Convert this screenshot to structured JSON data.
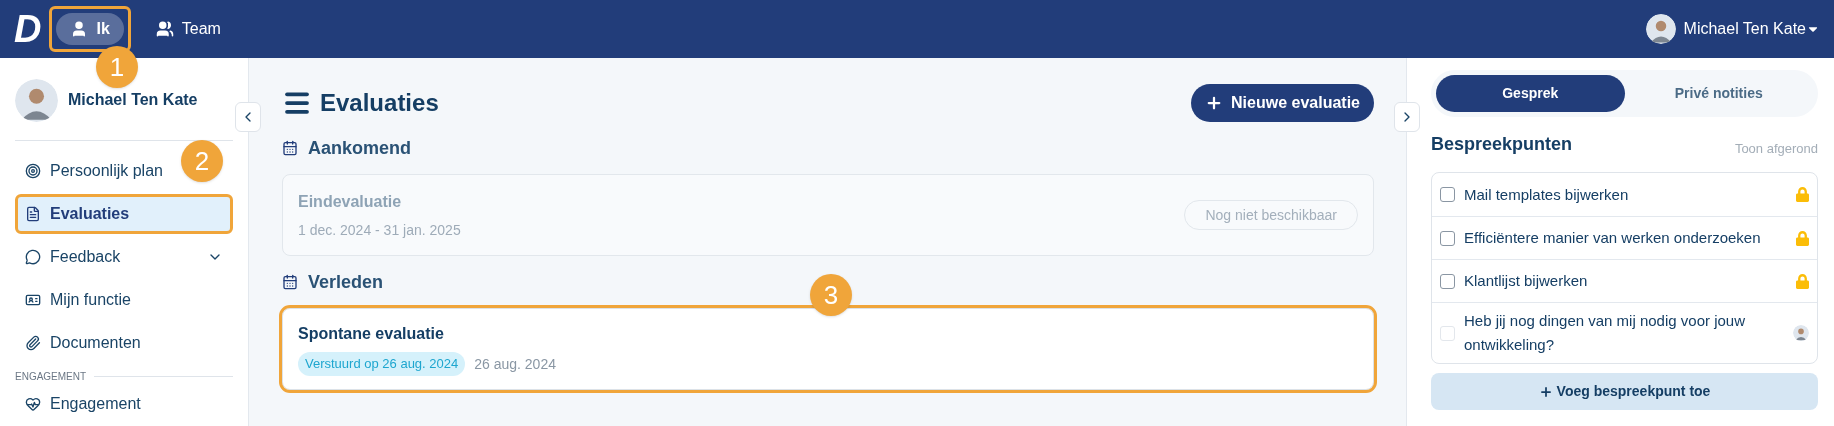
{
  "header": {
    "logo": "D",
    "nav": [
      {
        "label": "Ik",
        "selected": true,
        "highlighted": true
      },
      {
        "label": "Team",
        "selected": false,
        "highlighted": false
      }
    ],
    "user": {
      "name": "Michael Ten Kate"
    }
  },
  "sidebar": {
    "user_name": "Michael Ten Kate",
    "items": [
      {
        "label": "Persoonlijk plan",
        "selected": false,
        "highlighted": false,
        "kind": "link"
      },
      {
        "label": "Evaluaties",
        "selected": true,
        "highlighted": true,
        "kind": "link"
      },
      {
        "label": "Feedback",
        "selected": false,
        "highlighted": false,
        "kind": "expandable",
        "expanded": false
      },
      {
        "label": "Mijn functie",
        "selected": false,
        "highlighted": false,
        "kind": "link"
      },
      {
        "label": "Documenten",
        "selected": false,
        "highlighted": false,
        "kind": "link"
      }
    ],
    "section_label": "ENGAGEMENT",
    "section_items": [
      {
        "label": "Engagement",
        "selected": false
      }
    ]
  },
  "main": {
    "title": "Evaluaties",
    "new_button": "Nieuwe evaluatie",
    "sections": [
      {
        "title": "Aankomend",
        "cards": [
          {
            "title": "Eindevaluatie",
            "dates": "1 dec. 2024 - 31 jan. 2025",
            "disabled": true,
            "highlighted": false,
            "action": "Nog niet beschikbaar"
          }
        ]
      },
      {
        "title": "Verleden",
        "cards": [
          {
            "title": "Spontane evaluatie",
            "badge": "Verstuurd op 26 aug. 2024",
            "dates": "26 aug. 2024",
            "disabled": false,
            "highlighted": true
          }
        ]
      }
    ]
  },
  "panel": {
    "tabs": [
      {
        "label": "Gesprek",
        "selected": true
      },
      {
        "label": "Privé notities",
        "selected": false
      }
    ],
    "title": "Bespreekpunten",
    "toggle": "Toon afgerond",
    "items": [
      {
        "text": "Mail templates bijwerken",
        "checked": false,
        "disabled": false,
        "kind": "locked"
      },
      {
        "text": "Efficiëntere manier van werken onderzoeken",
        "checked": false,
        "disabled": false,
        "kind": "locked"
      },
      {
        "text": "Klantlijst bijwerken",
        "checked": false,
        "disabled": false,
        "kind": "locked"
      },
      {
        "text": "Heb jij nog dingen van mij nodig voor jouw ontwikkeling?",
        "checked": false,
        "disabled": true,
        "kind": "shared"
      }
    ],
    "add_button": "Voeg bespreekpunt toe"
  },
  "callouts": [
    "1",
    "2",
    "3"
  ]
}
